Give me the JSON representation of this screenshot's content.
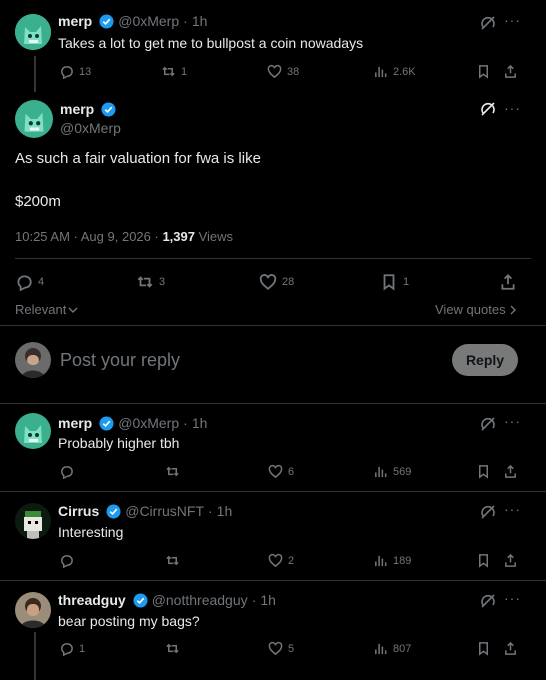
{
  "colors": {
    "background": "#000000",
    "text": "#e7e9ea",
    "muted": "#71767b",
    "divider": "#2f3336",
    "verified": "#1d9bf0",
    "reply_button_bg": "#787a7a"
  },
  "parent": {
    "name": "merp",
    "handle": "@0xMerp",
    "time": "1h",
    "text": "Takes a lot to get me to bullpost a coin nowadays",
    "replies": "13",
    "reposts": "1",
    "likes": "38",
    "views": "2.6K"
  },
  "main": {
    "name": "merp",
    "handle": "@0xMerp",
    "line1": "As such a fair valuation for fwa is like",
    "line2": "$200m",
    "timestamp": "10:25 AM · Aug 9, 2026 · ",
    "views_count": "1,397",
    "views_label": " Views",
    "replies": "4",
    "reposts": "3",
    "likes": "28",
    "bookmarks": "1",
    "sort_label": "Relevant",
    "view_quotes": "View quotes"
  },
  "compose": {
    "placeholder": "Post your reply",
    "button": "Reply"
  },
  "replies": [
    {
      "name": "merp",
      "handle": "@0xMerp",
      "time": "1h",
      "text": "Probably higher tbh",
      "replies": "",
      "reposts": "",
      "likes": "6",
      "views": "569"
    },
    {
      "name": "Cirrus",
      "handle": "@CirrusNFT",
      "time": "1h",
      "text": "Interesting",
      "replies": "",
      "reposts": "",
      "likes": "2",
      "views": "189"
    },
    {
      "name": "threadguy",
      "handle": "@notthreadguy",
      "time": "1h",
      "text": "bear posting my bags?",
      "replies": "1",
      "reposts": "",
      "likes": "5",
      "views": "807"
    }
  ],
  "sep": "·",
  "more": "···"
}
